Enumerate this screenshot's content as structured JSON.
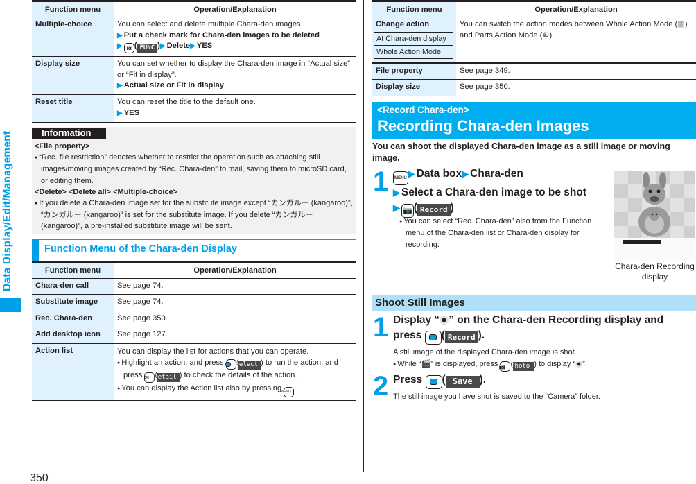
{
  "side_tab": {
    "label": "Data Display/Edit/Management",
    "color": "#00a0e9"
  },
  "page_number": "350",
  "left": {
    "table1": {
      "headers": [
        "Function menu",
        "Operation/Explanation"
      ],
      "rows": [
        {
          "menu": "Multiple-choice",
          "text": "You can select and delete multiple Chara-den images.",
          "step1": "Put a check mark for Chara-den images to be deleted",
          "key_label": "iα",
          "soft_label": "FUNC",
          "step2": "Delete",
          "step3": "YES"
        },
        {
          "menu": "Display size",
          "text": "You can set whether to display the Chara-den image in “Actual size” or “Fit in display”.",
          "step1": "Actual size or Fit in display"
        },
        {
          "menu": "Reset title",
          "text": "You can reset the title to the default one.",
          "step1": "YES"
        }
      ]
    },
    "information": {
      "label": "Information",
      "sections": [
        {
          "heading": "<File property>",
          "bullet": "“Rec. file restriction” denotes whether to restrict the operation such as attaching still images/moving images created by “Rec. Chara-den” to mail, saving them to microSD card, or editing them."
        },
        {
          "heading": "<Delete> <Delete all> <Multiple-choice>",
          "bullet": "If you delete a Chara-den image set for the substitute image except “カンガルー (kangaroo)”, “カンガルー (kangaroo)” is set for the substitute image. If you delete “カンガルー (kangaroo)”, a pre-installed substitute image will be sent."
        }
      ]
    },
    "section_title": "Function Menu of the Chara-den Display",
    "table2": {
      "headers": [
        "Function menu",
        "Operation/Explanation"
      ],
      "rows": [
        {
          "menu": "Chara-den call",
          "text": "See page 74."
        },
        {
          "menu": "Substitute image",
          "text": "See page 74."
        },
        {
          "menu": "Rec. Chara-den",
          "text": "See page 350."
        },
        {
          "menu": "Add desktop icon",
          "text": "See page 127."
        }
      ],
      "action_list": {
        "menu": "Action list",
        "text": "You can display the list for actions that you can operate.",
        "bullet1_a": "Highlight an action, and press",
        "soft_select": "Select",
        "bullet1_b": "to run the action; and press",
        "soft_detail": "Detail",
        "bullet1_c": "to check the details of the action.",
        "bullet2": "You can display the Action list also by pressing",
        "menu_key": "MENU"
      }
    }
  },
  "right": {
    "table": {
      "headers": [
        "Function menu",
        "Operation/Explanation"
      ],
      "change_action": {
        "menu": "Change action",
        "box": [
          "At Chara-den display",
          "Whole Action Mode"
        ],
        "text_a": "You can switch the action modes between Whole Action Mode (",
        "text_b": ") and Parts Action Mode (",
        "text_c": ")."
      },
      "rows": [
        {
          "menu": "File property",
          "text": "See page 349."
        },
        {
          "menu": "Display size",
          "text": "See page 350."
        }
      ]
    },
    "banner": {
      "subtitle": "<Record Chara-den>",
      "title": "Recording Chara-den Images",
      "color": "#00aeef"
    },
    "lead": "You can shoot the displayed Chara-den image as a still image or moving image.",
    "step1": {
      "num": "1",
      "menu_key": "MENU",
      "part1": "Data box",
      "part2": "Chara-den",
      "part3": "Select a Chara-den image to be shot",
      "soft": "Record",
      "note": "You can select “Rec. Chara-den” also from the Function menu of the Chara-den list or Chara-den display for recording."
    },
    "screenshot_caption": "Chara-den Recording display",
    "shoot_still": {
      "heading": "Shoot Still Images",
      "step1": {
        "num": "1",
        "text_a": "Display “",
        "text_b": "” on the Chara-den Recording display and press",
        "soft": "Record",
        "desc": "A still image of the displayed Chara-den image is shot.",
        "note_a": "While “",
        "note_b": "” is displayed, press",
        "soft_photo": "Photo",
        "note_c": "to display “",
        "note_d": "”."
      },
      "step2": {
        "num": "2",
        "text": "Press",
        "soft": "Save",
        "desc": "The still image you have shot is saved to the “Camera” folder."
      }
    }
  }
}
